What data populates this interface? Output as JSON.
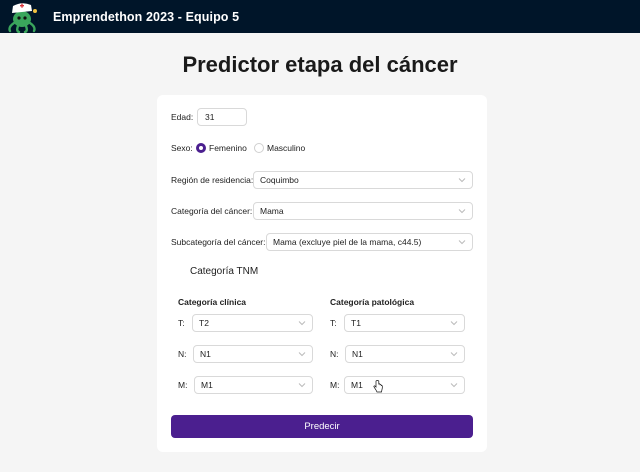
{
  "header": {
    "title": "Emprendethon 2023 - Equipo 5"
  },
  "page_title": "Predictor etapa del cáncer",
  "form": {
    "edad": {
      "label": "Edad",
      "value": "31"
    },
    "sexo": {
      "label": "Sexo",
      "options": [
        "Femenino",
        "Masculino"
      ],
      "selected": "Femenino"
    },
    "region": {
      "label": "Región de residencia",
      "value": "Coquimbo"
    },
    "categoria": {
      "label": "Categoría del cáncer",
      "value": "Mama"
    },
    "subcategoria": {
      "label": "Subcategoría del cáncer",
      "value": "Mama (excluye piel de la mama, c44.5)"
    },
    "tnm_title": "Categoría TNM",
    "clinica": {
      "heading": "Categoría clínica",
      "T": "T2",
      "N": "N1",
      "M": "M1"
    },
    "patologica": {
      "heading": "Categoría patológica",
      "T": "T1",
      "N": "N1",
      "M": "M1"
    },
    "tnm_labels": {
      "T": "T",
      "N": "N",
      "M": "M"
    },
    "colon": ":",
    "submit_label": "Predecir"
  },
  "colors": {
    "header_bg": "#001529",
    "accent": "#4b1f8f"
  }
}
